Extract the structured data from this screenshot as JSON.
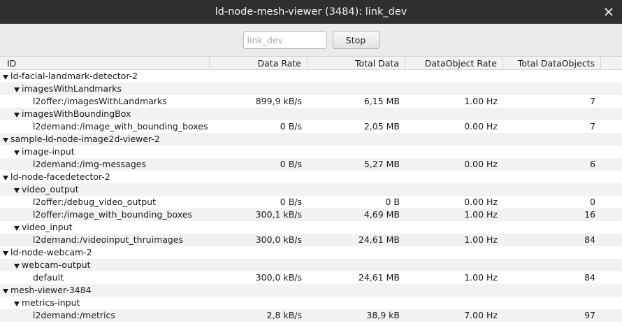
{
  "window": {
    "title": "ld-node-mesh-viewer (3484): link_dev"
  },
  "toolbar": {
    "filter_placeholder": "link_dev",
    "stop_label": "Stop"
  },
  "columns": {
    "id": "ID",
    "data_rate": "Data Rate",
    "total_data": "Total Data",
    "dataobject_rate": "DataObject Rate",
    "total_dataobjects": "Total DataObjects"
  },
  "rows": [
    {
      "level": 0,
      "expanded": true,
      "id": "ld-facial-landmark-detector-2",
      "data_rate": "",
      "total_data": "",
      "dataobject_rate": "",
      "total_dataobjects": ""
    },
    {
      "level": 1,
      "expanded": true,
      "id": "imagesWithLandmarks",
      "data_rate": "",
      "total_data": "",
      "dataobject_rate": "",
      "total_dataobjects": ""
    },
    {
      "level": 2,
      "expanded": false,
      "id": "l2offer:/imagesWithLandmarks",
      "data_rate": "899,9 kB/s",
      "total_data": "6,15 MB",
      "dataobject_rate": "1.00 Hz",
      "total_dataobjects": "7"
    },
    {
      "level": 1,
      "expanded": true,
      "id": "imagesWithBoundingBox",
      "data_rate": "",
      "total_data": "",
      "dataobject_rate": "",
      "total_dataobjects": ""
    },
    {
      "level": 2,
      "expanded": false,
      "id": "l2demand:/image_with_bounding_boxes",
      "data_rate": "0 B/s",
      "total_data": "2,05 MB",
      "dataobject_rate": "0.00 Hz",
      "total_dataobjects": "7"
    },
    {
      "level": 0,
      "expanded": true,
      "id": "sample-ld-node-image2d-viewer-2",
      "data_rate": "",
      "total_data": "",
      "dataobject_rate": "",
      "total_dataobjects": ""
    },
    {
      "level": 1,
      "expanded": true,
      "id": "image-input",
      "data_rate": "",
      "total_data": "",
      "dataobject_rate": "",
      "total_dataobjects": ""
    },
    {
      "level": 2,
      "expanded": false,
      "id": "l2demand:/img-messages",
      "data_rate": "0 B/s",
      "total_data": "5,27 MB",
      "dataobject_rate": "0.00 Hz",
      "total_dataobjects": "6"
    },
    {
      "level": 0,
      "expanded": true,
      "id": "ld-node-facedetector-2",
      "data_rate": "",
      "total_data": "",
      "dataobject_rate": "",
      "total_dataobjects": ""
    },
    {
      "level": 1,
      "expanded": true,
      "id": "video_output",
      "data_rate": "",
      "total_data": "",
      "dataobject_rate": "",
      "total_dataobjects": ""
    },
    {
      "level": 2,
      "expanded": false,
      "id": "l2offer:/debug_video_output",
      "data_rate": "0 B/s",
      "total_data": "0 B",
      "dataobject_rate": "0.00 Hz",
      "total_dataobjects": "0"
    },
    {
      "level": 2,
      "expanded": false,
      "id": "l2offer:/image_with_bounding_boxes",
      "data_rate": "300,1 kB/s",
      "total_data": "4,69 MB",
      "dataobject_rate": "1.00 Hz",
      "total_dataobjects": "16"
    },
    {
      "level": 1,
      "expanded": true,
      "id": "video_input",
      "data_rate": "",
      "total_data": "",
      "dataobject_rate": "",
      "total_dataobjects": ""
    },
    {
      "level": 2,
      "expanded": false,
      "id": "l2demand:/videoinput_thruimages",
      "data_rate": "300,0 kB/s",
      "total_data": "24,61 MB",
      "dataobject_rate": "1.00 Hz",
      "total_dataobjects": "84"
    },
    {
      "level": 0,
      "expanded": true,
      "id": "ld-node-webcam-2",
      "data_rate": "",
      "total_data": "",
      "dataobject_rate": "",
      "total_dataobjects": ""
    },
    {
      "level": 1,
      "expanded": true,
      "id": "webcam-output",
      "data_rate": "",
      "total_data": "",
      "dataobject_rate": "",
      "total_dataobjects": ""
    },
    {
      "level": 2,
      "expanded": false,
      "id": "default",
      "data_rate": "300,0 kB/s",
      "total_data": "24,61 MB",
      "dataobject_rate": "1.00 Hz",
      "total_dataobjects": "84"
    },
    {
      "level": 0,
      "expanded": true,
      "id": "mesh-viewer-3484",
      "data_rate": "",
      "total_data": "",
      "dataobject_rate": "",
      "total_dataobjects": ""
    },
    {
      "level": 1,
      "expanded": true,
      "id": "metrics-input",
      "data_rate": "",
      "total_data": "",
      "dataobject_rate": "",
      "total_dataobjects": ""
    },
    {
      "level": 2,
      "expanded": false,
      "id": "l2demand:/metrics",
      "data_rate": "2,8 kB/s",
      "total_data": "38,9 kB",
      "dataobject_rate": "7.00 Hz",
      "total_dataobjects": "97"
    }
  ],
  "icons": {
    "close": "close-icon",
    "expander": "expander-arrow-icon"
  }
}
